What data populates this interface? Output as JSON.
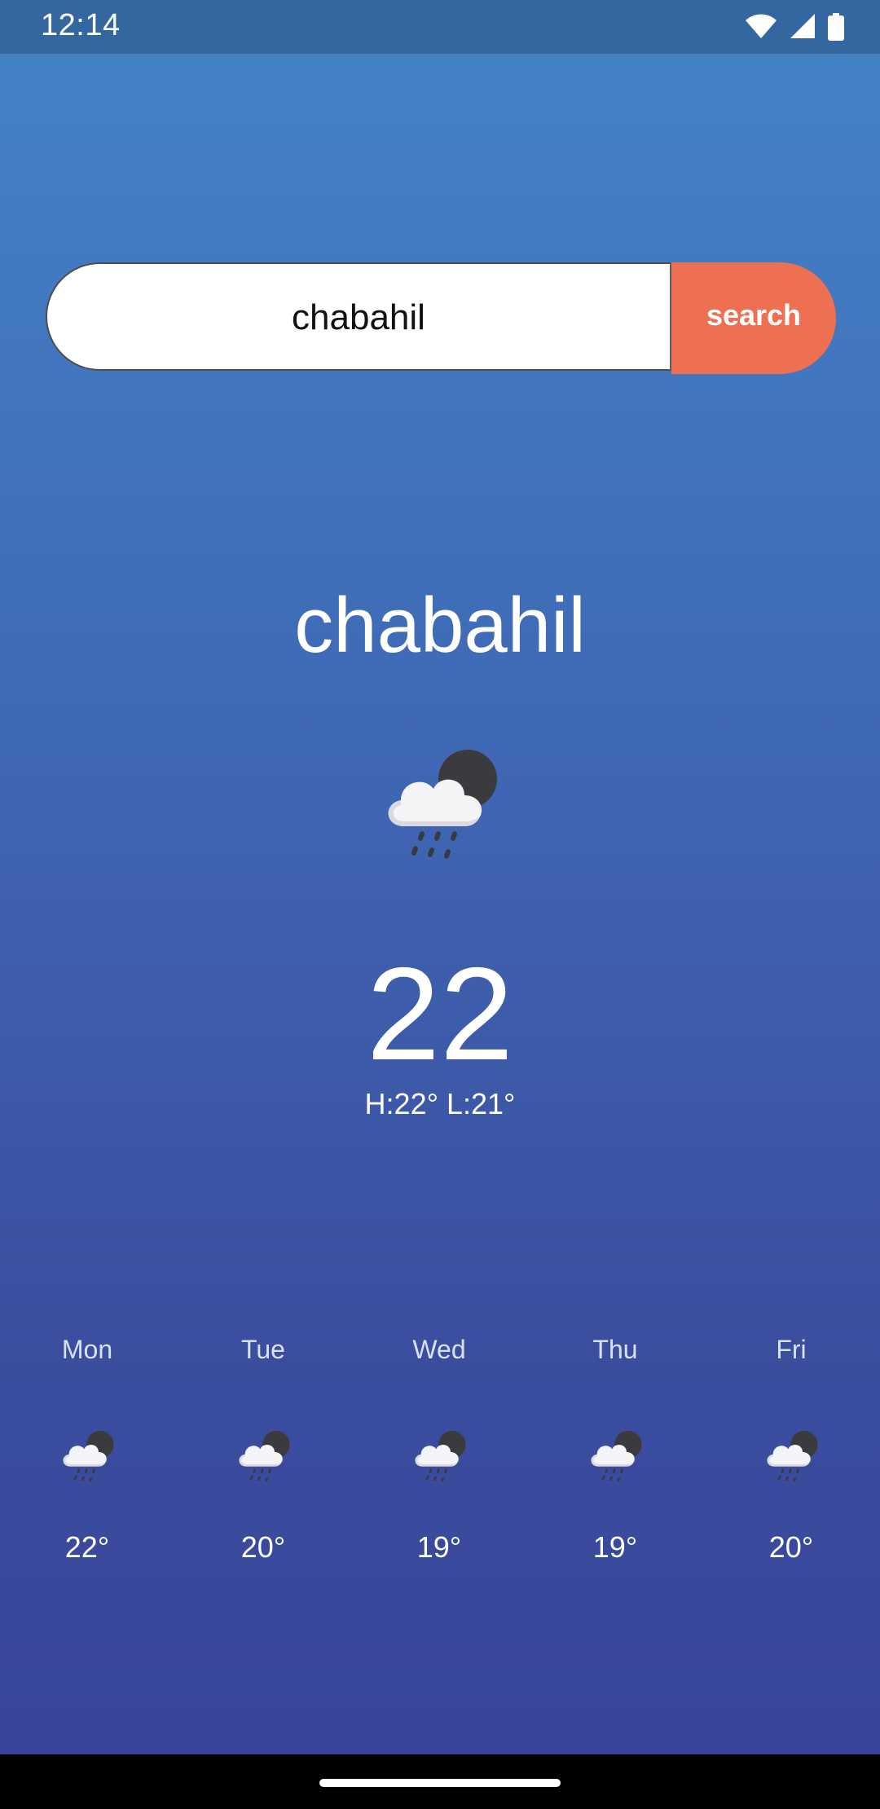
{
  "status_bar": {
    "time": "12:14",
    "icons": [
      "wifi-icon",
      "signal-icon",
      "battery-icon"
    ]
  },
  "search": {
    "value": "chabahil",
    "button_label": "search",
    "button_color": "#ec7051"
  },
  "current": {
    "city": "chabahil",
    "icon": "cloud-rain-night-icon",
    "temperature": "22",
    "hi_lo": "H:22° L:21°"
  },
  "forecast": [
    {
      "day": "Mon",
      "icon": "cloud-rain-night-icon",
      "temp": "22°"
    },
    {
      "day": "Tue",
      "icon": "cloud-rain-night-icon",
      "temp": "20°"
    },
    {
      "day": "Wed",
      "icon": "cloud-rain-night-icon",
      "temp": "19°"
    },
    {
      "day": "Thu",
      "icon": "cloud-rain-night-icon",
      "temp": "19°"
    },
    {
      "day": "Fri",
      "icon": "cloud-rain-night-icon",
      "temp": "20°"
    }
  ],
  "colors": {
    "background_top": "#4484c8",
    "background_bottom": "#38449a",
    "status_bar": "#34679f"
  }
}
